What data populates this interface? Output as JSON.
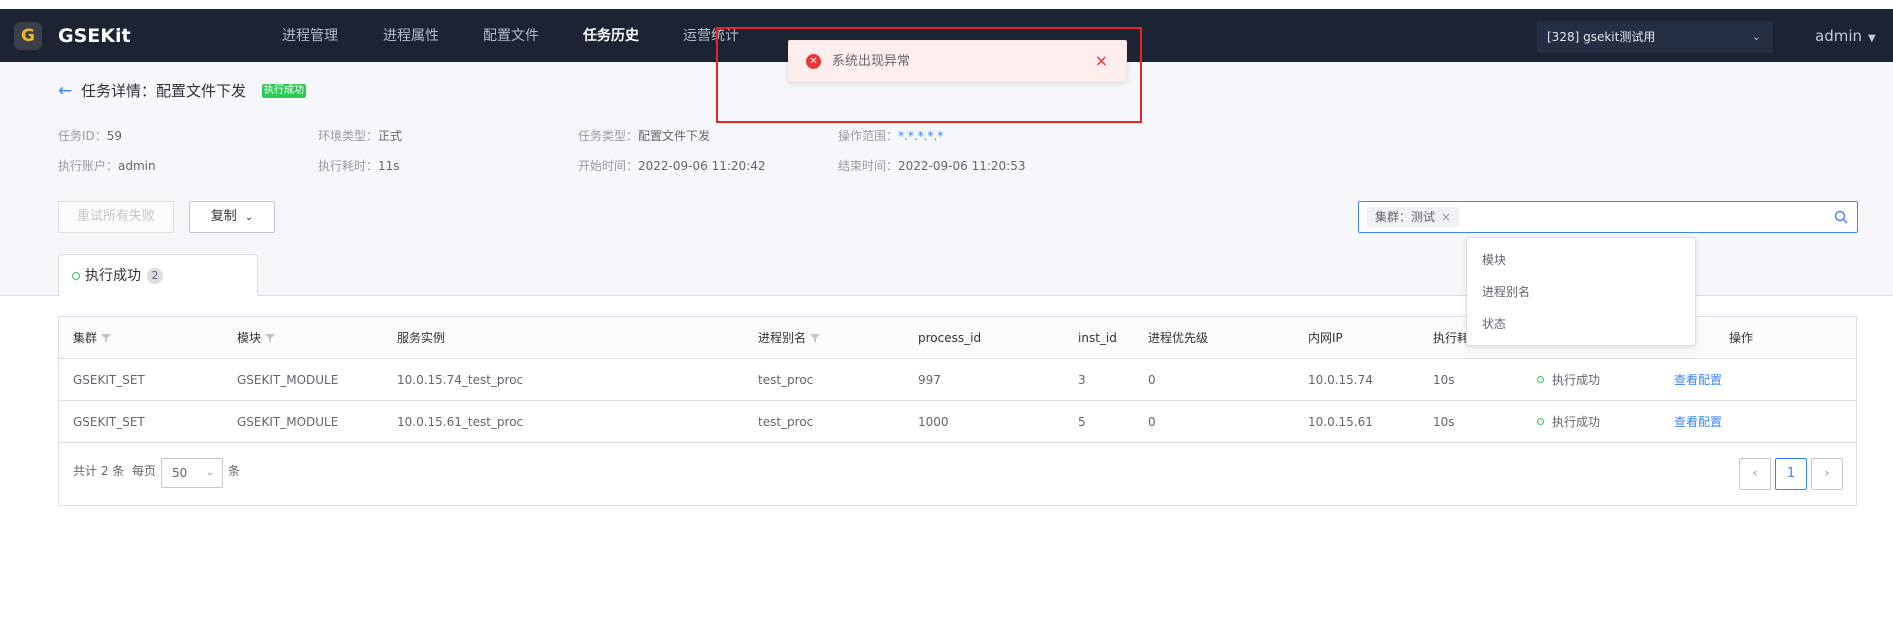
{
  "nav": {
    "logo": "G",
    "brand": "GSEKit",
    "items": [
      "进程管理",
      "进程属性",
      "配置文件",
      "任务历史",
      "运营统计"
    ],
    "active_index": 3,
    "business_select": "[328] gsekit测试用",
    "user": "admin"
  },
  "task": {
    "title": "任务详情：配置文件下发",
    "status_badge": "执行成功",
    "info": [
      {
        "label": "任务ID：",
        "value": "59"
      },
      {
        "label": "环境类型：",
        "value": "正式"
      },
      {
        "label": "任务类型：",
        "value": "配置文件下发"
      },
      {
        "label": "操作范围：",
        "value": "*.*.*.*.*"
      },
      {
        "label": "执行账户：",
        "value": "admin"
      },
      {
        "label": "执行耗时：",
        "value": "11s"
      },
      {
        "label": "开始时间：",
        "value": "2022-09-06 11:20:42"
      },
      {
        "label": "结束时间：",
        "value": "2022-09-06 11:20:53"
      }
    ]
  },
  "actions": {
    "retry_label": "重试所有失败",
    "copy_label": "复制"
  },
  "search": {
    "tag": "集群：测试"
  },
  "dropdown": [
    "模块",
    "进程别名",
    "状态"
  ],
  "tab": {
    "label": "执行成功",
    "count": "2"
  },
  "table": {
    "headers": [
      "集群",
      "模块",
      "服务实例",
      "进程别名",
      "process_id",
      "inst_id",
      "进程优先级",
      "内网IP",
      "执行耗",
      "操作"
    ],
    "rows": [
      [
        "GSEKIT_SET",
        "GSEKIT_MODULE",
        "10.0.15.74_test_proc",
        "test_proc",
        "997",
        "3",
        "0",
        "10.0.15.74",
        "10s",
        "执行成功",
        "查看配置"
      ],
      [
        "GSEKIT_SET",
        "GSEKIT_MODULE",
        "10.0.15.61_test_proc",
        "test_proc",
        "1000",
        "5",
        "0",
        "10.0.15.61",
        "10s",
        "执行成功",
        "查看配置"
      ]
    ]
  },
  "pager": {
    "total": "共计 2 条",
    "per_page_label": "每页",
    "per_page": "50",
    "unit": "条",
    "current": "1"
  },
  "toast": {
    "message": "系统出现异常"
  },
  "colors": {
    "primary": "#3a84ff",
    "success": "#2dcb56",
    "danger": "#ea3636",
    "nav_bg": "#1c2433"
  }
}
